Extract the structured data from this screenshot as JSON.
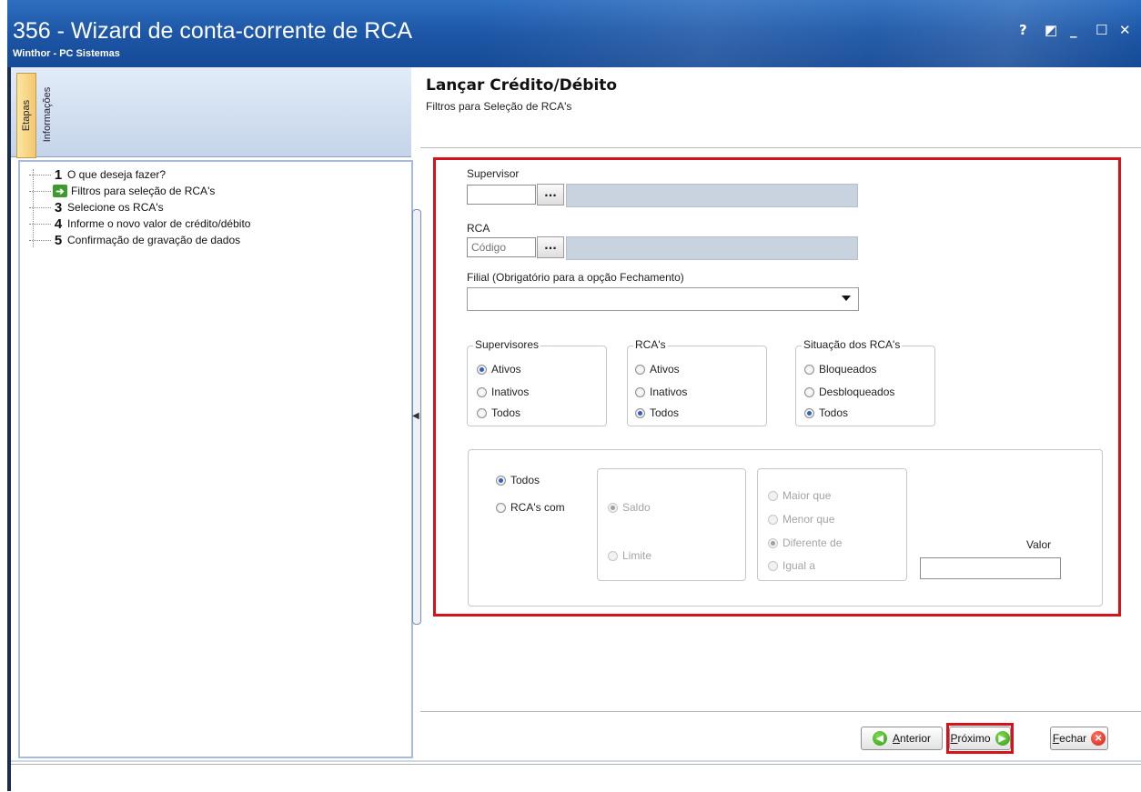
{
  "window": {
    "title": "356 - Wizard de conta-corrente de RCA",
    "subtitle": "Winthor - PC Sistemas",
    "controls": {
      "help": "?",
      "restore": "◩",
      "minimize": "_",
      "maximize": "☐",
      "close": "✕"
    }
  },
  "left_tabs": [
    "Etapas",
    "Informações"
  ],
  "steps": [
    {
      "marker": "1",
      "label": "O que deseja fazer?"
    },
    {
      "marker": "➔",
      "label": "Filtros para seleção de RCA's",
      "current": true
    },
    {
      "marker": "3",
      "label": "Selecione os RCA's"
    },
    {
      "marker": "4",
      "label": "Informe o novo valor de crédito/débito"
    },
    {
      "marker": "5",
      "label": "Confirmação de gravação de dados"
    }
  ],
  "page": {
    "title": "Lançar Crédito/Débito",
    "subtitle": "Filtros para Seleção de RCA's"
  },
  "form": {
    "supervisor": {
      "label": "Supervisor",
      "code_value": "",
      "lookup_label": "..."
    },
    "rca": {
      "label": "RCA",
      "code_placeholder": "Código",
      "lookup_label": "..."
    },
    "filial": {
      "label": "Filial (Obrigatório para a opção Fechamento)",
      "value": ""
    },
    "supervisores": {
      "title": "Supervisores",
      "options": [
        "Ativos",
        "Inativos",
        "Todos"
      ],
      "selected": "Ativos"
    },
    "rcas": {
      "title": "RCA's",
      "options": [
        "Ativos",
        "Inativos",
        "Todos"
      ],
      "selected": "Todos"
    },
    "situacao": {
      "title": "Situação dos RCA's",
      "options": [
        "Bloqueados",
        "Desbloqueados",
        "Todos"
      ],
      "selected": "Todos"
    },
    "filtro": {
      "options": [
        "Todos",
        "RCA's com"
      ],
      "selected": "Todos"
    },
    "tipo": {
      "options": [
        "Saldo",
        "Limite"
      ],
      "selected": "Saldo",
      "enabled": false
    },
    "comparacao": {
      "options": [
        "Maior que",
        "Menor que",
        "Diferente de",
        "Igual a"
      ],
      "selected": "Diferente de",
      "enabled": false
    },
    "valor": {
      "label": "Valor",
      "value": ""
    }
  },
  "buttons": {
    "anterior": {
      "hotkey": "A",
      "rest": "nterior"
    },
    "proximo": {
      "hotkey": "P",
      "rest": "róximo"
    },
    "fechar": {
      "hotkey": "F",
      "rest": "echar"
    }
  },
  "colors": {
    "highlight": "#d6121b",
    "titlebar": "#1d56a6",
    "step_arrow": "#3d9a2c"
  }
}
